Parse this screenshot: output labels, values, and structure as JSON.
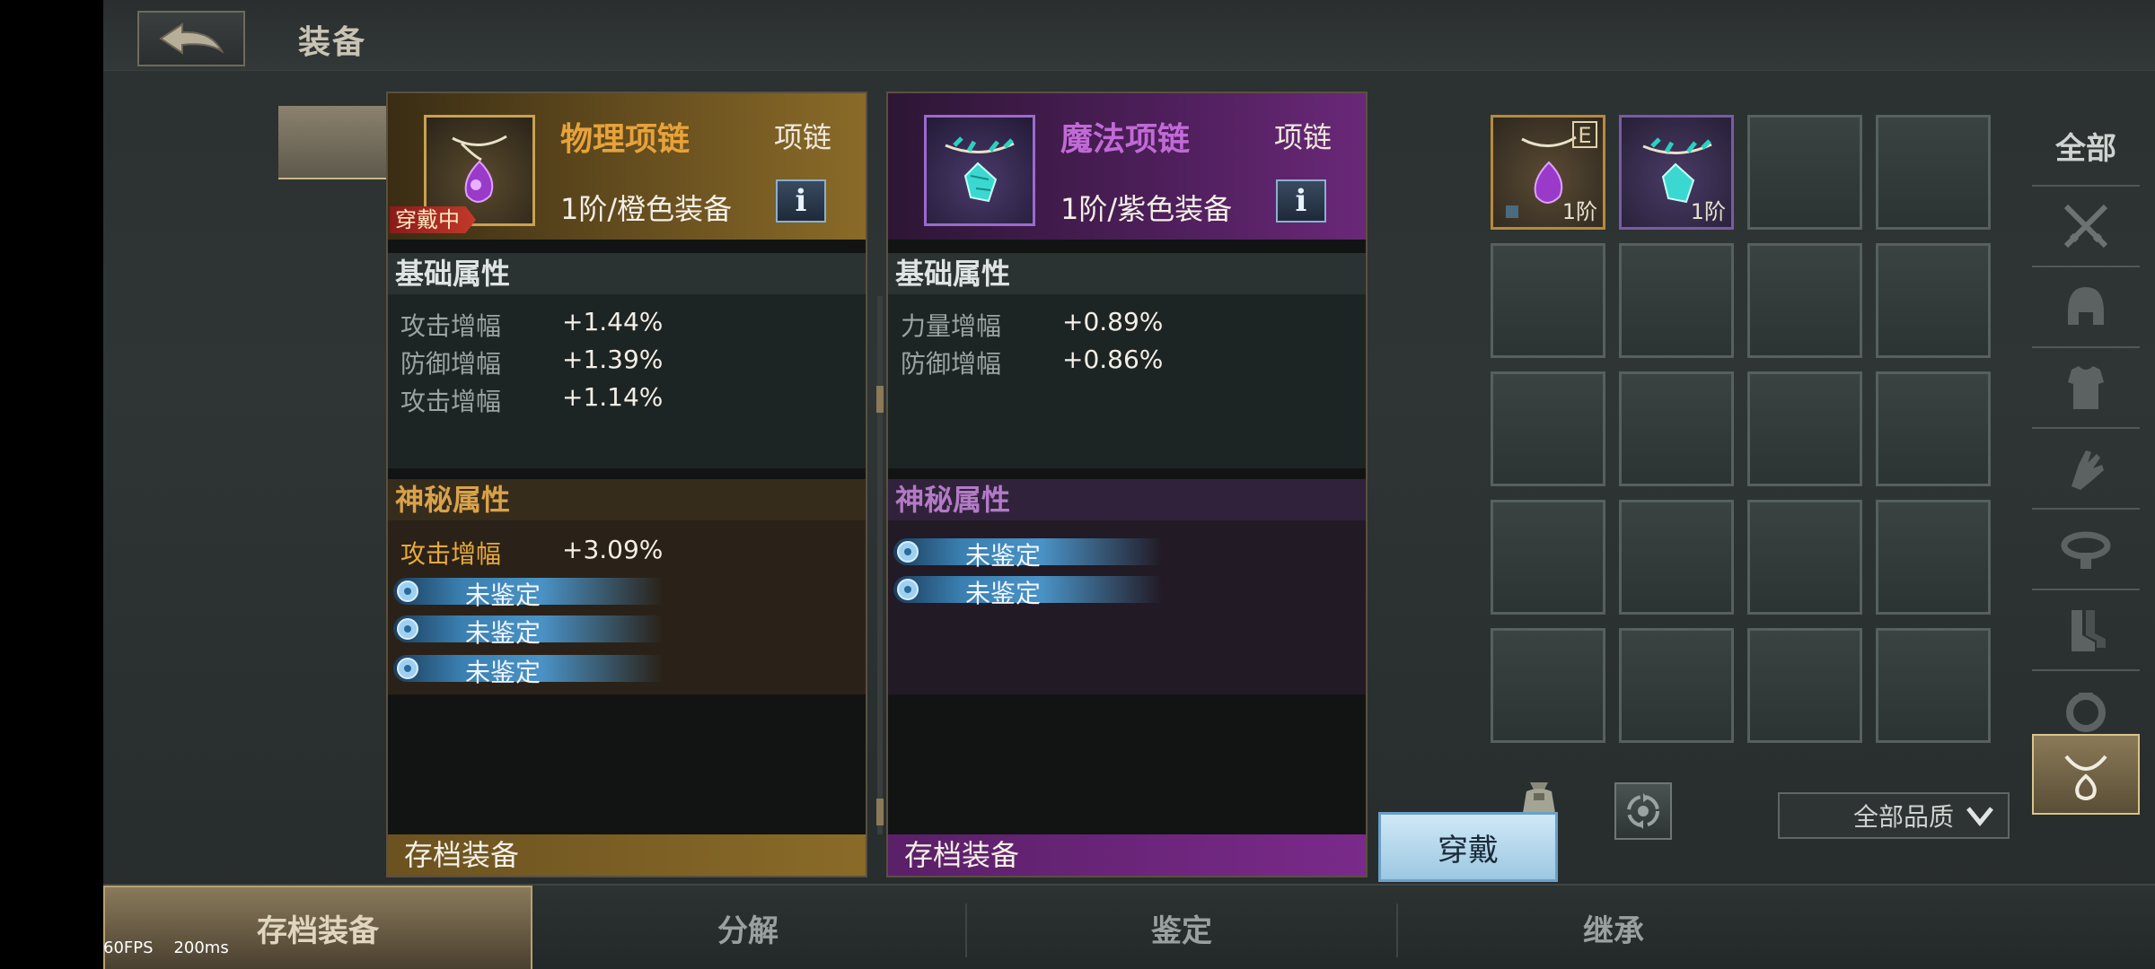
{
  "header": {
    "title": "装备"
  },
  "panels": [
    {
      "name": "物理项链",
      "type": "项链",
      "grade": "1阶/橙色装备",
      "equipped_tag": "穿戴中",
      "info_label": "i",
      "base_title": "基础属性",
      "base_attrs": [
        {
          "name": "攻击增幅",
          "value": "+1.44%"
        },
        {
          "name": "防御增幅",
          "value": "+1.39%"
        },
        {
          "name": "攻击增幅",
          "value": "+1.14%"
        }
      ],
      "mystic_title": "神秘属性",
      "mystic_attrs": [
        {
          "name": "攻击增幅",
          "value": "+3.09%"
        }
      ],
      "unidentified": [
        "未鉴定",
        "未鉴定",
        "未鉴定"
      ],
      "footer": "存档装备",
      "quality_color": "#e7a23a"
    },
    {
      "name": "魔法项链",
      "type": "项链",
      "grade": "1阶/紫色装备",
      "info_label": "i",
      "base_title": "基础属性",
      "base_attrs": [
        {
          "name": "力量增幅",
          "value": "+0.89%"
        },
        {
          "name": "防御增幅",
          "value": "+0.86%"
        }
      ],
      "mystic_title": "神秘属性",
      "unidentified": [
        "未鉴定",
        "未鉴定"
      ],
      "footer": "存档装备",
      "quality_color": "#c16ad6"
    }
  ],
  "inventory": {
    "slots": [
      {
        "level": "1阶",
        "badge": "E",
        "quality": "orange",
        "icon": "purple-gem-necklace-icon"
      },
      {
        "level": "1阶",
        "quality": "purple",
        "icon": "cyan-crystal-necklace-icon"
      }
    ],
    "empty_slots": 18
  },
  "categories": [
    {
      "label": "全部",
      "icon": ""
    },
    {
      "icon": "crossed-swords-icon"
    },
    {
      "icon": "helmet-icon"
    },
    {
      "icon": "armor-icon"
    },
    {
      "icon": "gauntlet-icon"
    },
    {
      "icon": "belt-icon"
    },
    {
      "icon": "boots-icon"
    },
    {
      "icon": "ring-icon"
    },
    {
      "icon": "necklace-icon",
      "selected": true
    }
  ],
  "actions": {
    "wear": "穿戴",
    "quality_filter": "全部品质"
  },
  "bottom_tabs": [
    {
      "label": "存档装备",
      "active": true
    },
    {
      "label": "分解"
    },
    {
      "label": "鉴定"
    },
    {
      "label": "继承"
    }
  ],
  "debug": {
    "fps": "60FPS",
    "ping": "200ms"
  }
}
